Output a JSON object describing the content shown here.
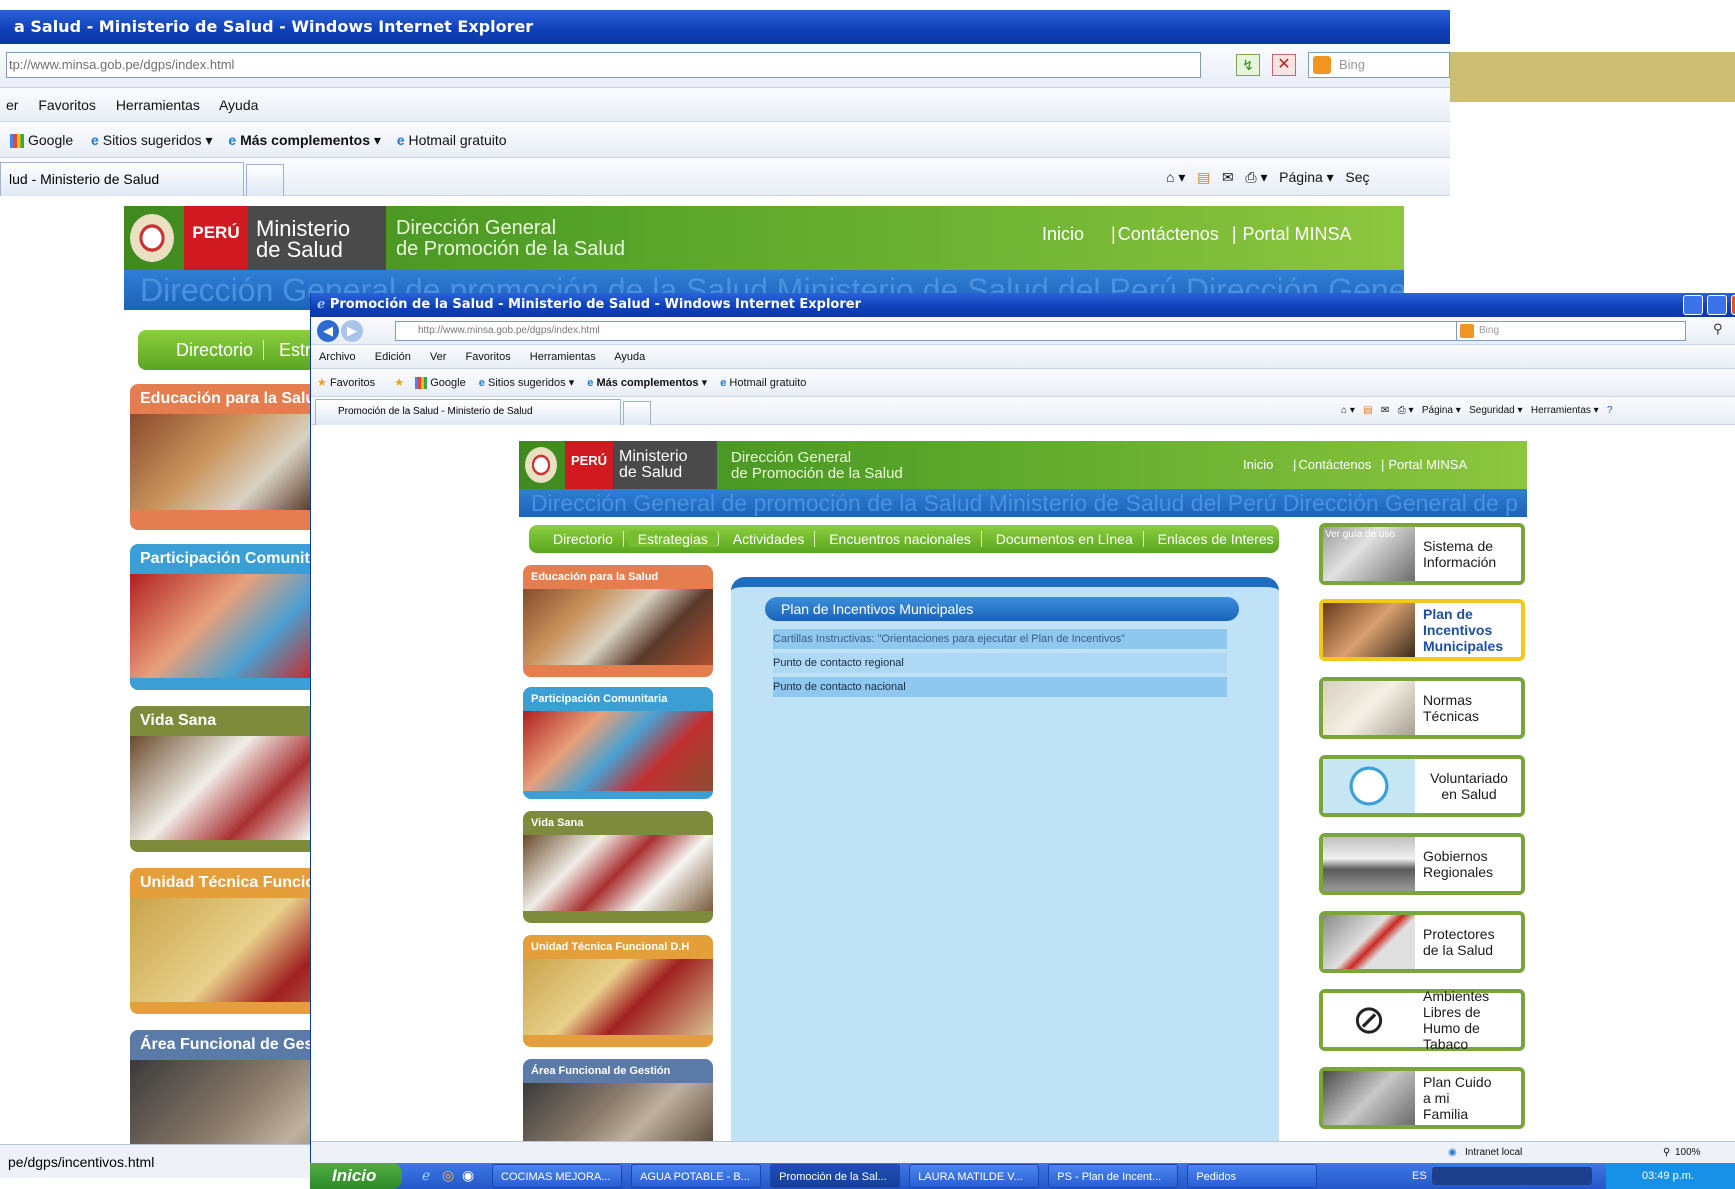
{
  "back_window": {
    "title": "a Salud - Ministerio de Salud - Windows Internet Explorer",
    "address_url": "tp://www.minsa.gob.pe/dgps/index.html",
    "search_placeholder": "Bing",
    "menu": [
      "er",
      "Favoritos",
      "Herramientas",
      "Ayuda"
    ],
    "favorites": [
      "Google",
      "Sitios sugeridos",
      "Más complementos",
      "Hotmail gratuito"
    ],
    "tab_title": "lud - Ministerio de Salud",
    "command_labels": [
      "Página",
      "Seç"
    ],
    "status_url": "pe/dgps/incentivos.html",
    "header": {
      "peru": "PERÚ",
      "ministerio": "Ministerio",
      "de_salud": "de Salud",
      "dir1": "Dirección General",
      "dir2": "de Promoción de la Salud",
      "links": [
        "Inicio",
        "Contáctenos",
        "Portal MINSA"
      ]
    },
    "marquee": "Dirección General de promoción de la Salud  Ministerio de Salud del Perú  Dirección General de p",
    "nav": [
      "Directorio",
      "Estra"
    ],
    "cards": [
      "Educación para la Salud",
      "Participación Comunitar",
      "Vida Sana",
      "Unidad Técnica Funciona",
      "Área Funcional de Gesti"
    ]
  },
  "front_window": {
    "title": "Promoción de la Salud - Ministerio de Salud - Windows Internet Explorer",
    "address_url": "http://www.minsa.gob.pe/dgps/index.html",
    "search_placeholder": "Bing",
    "menu": [
      "Archivo",
      "Edición",
      "Ver",
      "Favoritos",
      "Herramientas",
      "Ayuda"
    ],
    "favorites_label": "Favoritos",
    "favorites": [
      "Google",
      "Sitios sugeridos",
      "Más complementos",
      "Hotmail gratuito"
    ],
    "tab_title": "Promoción de la Salud - Ministerio de Salud",
    "command_labels": [
      "Página",
      "Seguridad",
      "Herramientas"
    ],
    "header": {
      "peru": "PERÚ",
      "ministerio": "Ministerio",
      "de_salud": "de Salud",
      "dir1": "Dirección General",
      "dir2": "de Promoción de la Salud",
      "links": [
        "Inicio",
        "Contáctenos",
        "Portal MINSA"
      ]
    },
    "marquee": "Dirección General de promoción de la Salud  Ministerio de Salud del Perú  Dirección General de p",
    "nav": [
      "Directorio",
      "Estrategias",
      "Actividades",
      "Encuentros nacionales",
      "Documentos en Línea",
      "Enlaces de Interes"
    ],
    "cards": [
      "Educación para la Salud",
      "Participación Comunitaria",
      "Vida Sana",
      "Unidad Técnica Funcional D.H",
      "Área Funcional de Gestión"
    ],
    "panel": {
      "title": "Plan de Incentivos Municipales",
      "links": [
        "Cartillas Instructivas: \"Orientaciones para ejecutar el Plan de Incentivos\"",
        "Punto de contacto regional",
        "Punto de contacto nacional"
      ]
    },
    "right_boxes": [
      {
        "label": "Sistema de Información",
        "note": "Ver guía de uso"
      },
      {
        "label": "Plan de Incentivos Municipales"
      },
      {
        "label": "Normas Técnicas"
      },
      {
        "label": "Voluntariado en Salud"
      },
      {
        "label": "Gobiernos Regionales"
      },
      {
        "label": "Protectores de la Salud"
      },
      {
        "label": "Ambientes Libres de Humo de Tabaco"
      },
      {
        "label": "Plan Cuido a mi Familia"
      }
    ],
    "status": {
      "zone": "Intranet local",
      "zoom": "100%"
    }
  },
  "taskbar": {
    "start": "Inicio",
    "items": [
      "COCIMAS MEJORA...",
      "AGUA POTABLE - B...",
      "Promoción de la Sal...",
      "LAURA MATILDE V...",
      "PS - Plan de Incent...",
      "Pedidos"
    ],
    "lang": "ES",
    "time": "03:49 p.m."
  },
  "colors": {
    "gold_bar": "#cdbd75",
    "green": "#5aa521",
    "ie_blue": "#0f3fb8",
    "panel_blue": "#bfe2f7"
  }
}
